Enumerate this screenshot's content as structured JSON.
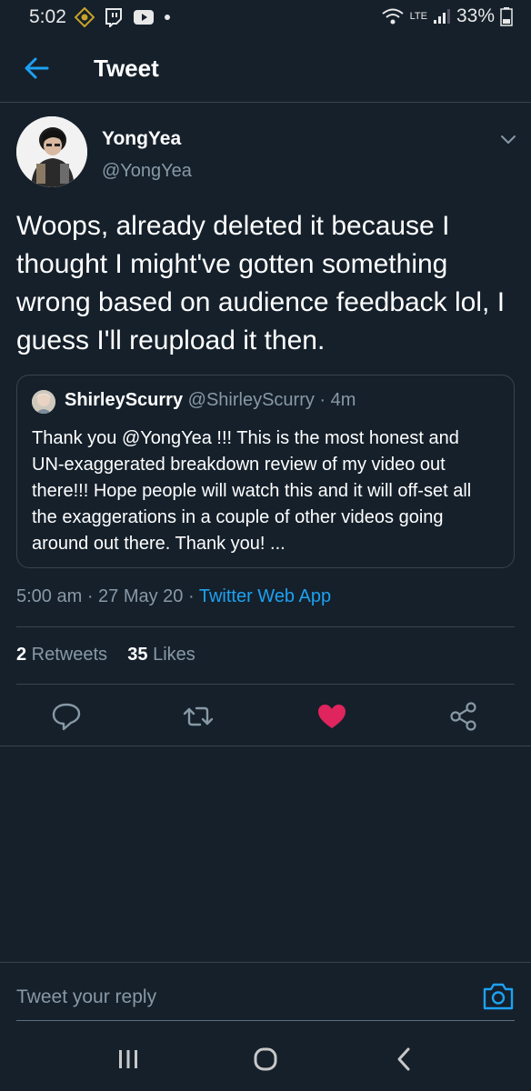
{
  "status_bar": {
    "time": "5:02",
    "battery": "33%",
    "network": "LTE"
  },
  "header": {
    "title": "Tweet",
    "back_icon": "arrow-left-icon"
  },
  "tweet": {
    "author_name": "YongYea",
    "author_handle": "@YongYea",
    "text": "Woops, already deleted it because I thought I might've gotten something wrong based on audience feedback lol, I guess I'll reupload it then.",
    "timestamp": "5:00 am · 27 May 20 · ",
    "source": "Twitter Web App",
    "retweets_count": "2",
    "retweets_label": " Retweets",
    "likes_count": "35",
    "likes_label": " Likes"
  },
  "quoted_tweet": {
    "author_name": "ShirleyScurry",
    "author_handle": "@ShirleyScurry",
    "time_ago": " · 4m",
    "text": "Thank you @YongYea !!!  This is the most honest and UN-exaggerated breakdown review of my video out there!!! Hope people will watch this and it will off-set all the exaggerations in a couple of other videos going around out there.  Thank you!  ..."
  },
  "actions": [
    "reply-icon",
    "retweet-icon",
    "like-icon",
    "share-icon"
  ],
  "reply": {
    "placeholder": "Tweet your reply"
  },
  "colors": {
    "background": "#15202b",
    "accent": "#1da1f2",
    "like": "#e0245e",
    "muted": "#8899a6",
    "border": "#38444d"
  }
}
